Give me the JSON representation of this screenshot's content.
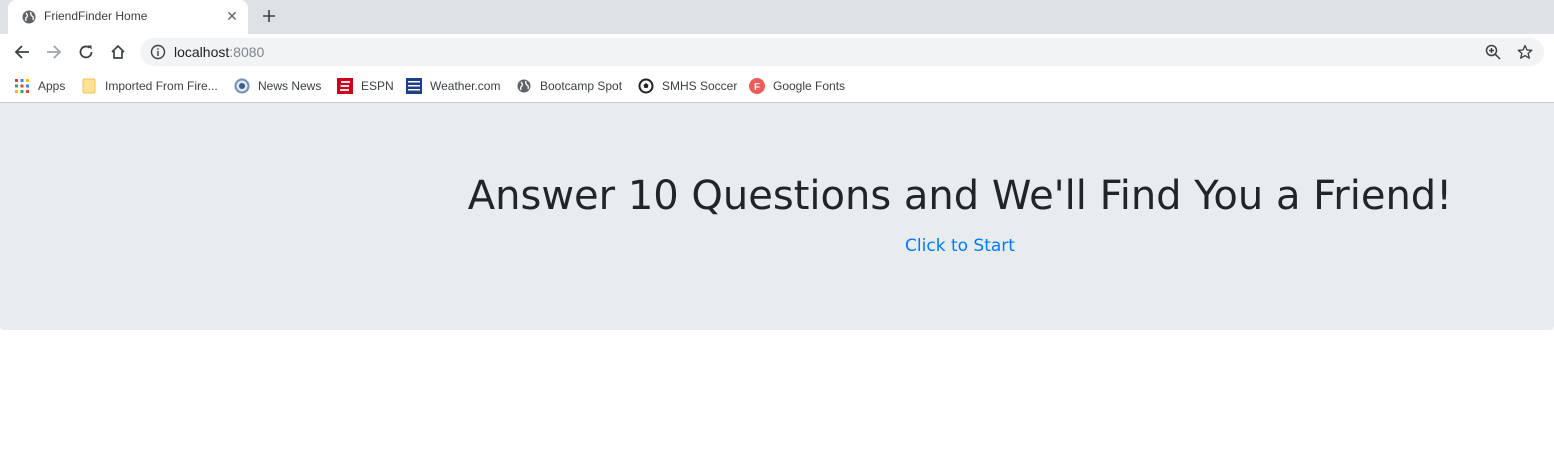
{
  "browser": {
    "tab": {
      "title": "FriendFinder Home",
      "favicon": "globe-icon",
      "close": "close-icon"
    },
    "new_tab": "plus-icon",
    "address": {
      "host": "localhost",
      "port": ":8080"
    },
    "bookmarks": [
      {
        "label": "Apps",
        "icon": "apps-grid-icon"
      },
      {
        "label": "Imported From Fire...",
        "icon": "folder-icon"
      },
      {
        "label": "News News",
        "icon": "news-icon"
      },
      {
        "label": "ESPN",
        "icon": "espn-icon"
      },
      {
        "label": "Weather.com",
        "icon": "weather-channel-icon"
      },
      {
        "label": "Bootcamp Spot",
        "icon": "globe-icon"
      },
      {
        "label": "SMHS Soccer",
        "icon": "soccer-ball-icon"
      },
      {
        "label": "Google Fonts",
        "icon": "google-fonts-icon"
      }
    ]
  },
  "page": {
    "headline": "Answer 10 Questions and We'll Find You a Friend!",
    "start_link": "Click to Start"
  },
  "colors": {
    "jumbotron_bg": "#e9ecef",
    "link": "#007bff",
    "heading": "#212529"
  }
}
